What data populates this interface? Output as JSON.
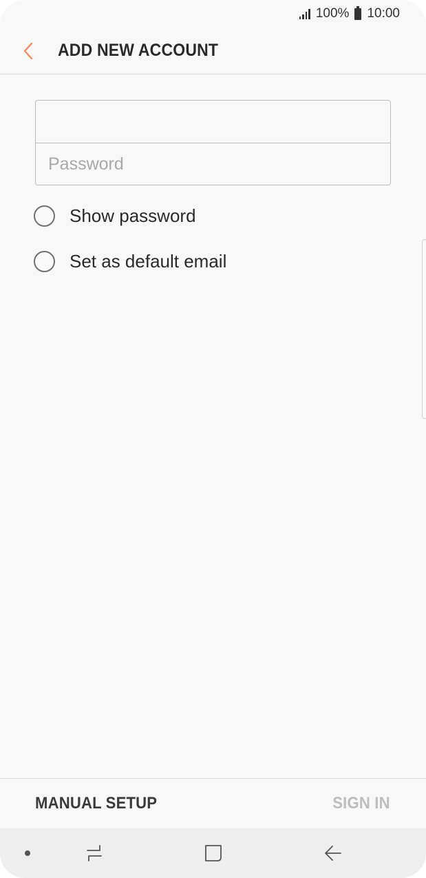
{
  "status_bar": {
    "battery": "100%",
    "time": "10:00",
    "icons": [
      "signal-icon",
      "battery-icon"
    ]
  },
  "header": {
    "title": "ADD NEW ACCOUNT",
    "back_icon": "chevron-left-icon",
    "accent_color": "#f08a5d"
  },
  "form": {
    "email": {
      "value": "",
      "placeholder": ""
    },
    "password": {
      "value": "",
      "placeholder": "Password"
    }
  },
  "options": [
    {
      "label": "Show password",
      "checked": false
    },
    {
      "label": "Set as default email",
      "checked": false
    }
  ],
  "actions": {
    "manual_setup": "MANUAL SETUP",
    "sign_in": "SIGN IN",
    "sign_in_enabled": false
  },
  "nav_bar": {
    "items": [
      "dot-icon",
      "recent-apps-icon",
      "home-icon",
      "back-arrow-icon"
    ]
  }
}
